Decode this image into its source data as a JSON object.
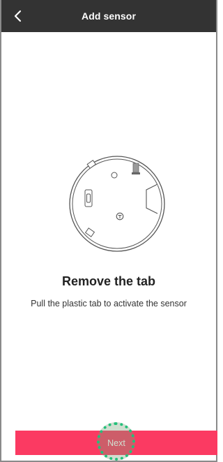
{
  "header": {
    "title": "Add sensor",
    "back_icon": "chevron-left-icon",
    "background": "#333333"
  },
  "illustration": {
    "icon": "sensor-device-icon",
    "stroke_color": "#555555"
  },
  "content": {
    "heading": "Remove the tab",
    "description": "Pull the plastic tab to activate the sensor"
  },
  "footer": {
    "next_label": "Next",
    "button_color": "#fb3a62"
  },
  "tap_indicator": {
    "color": "#22c07a"
  }
}
